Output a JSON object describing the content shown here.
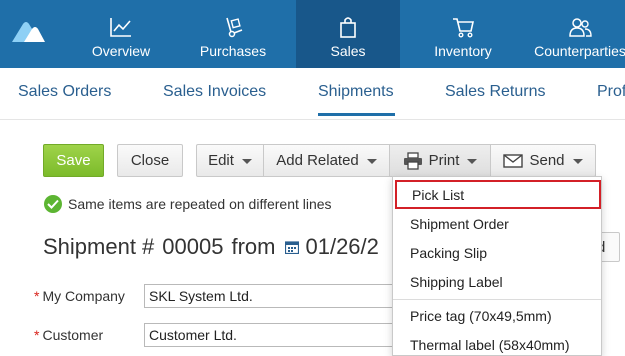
{
  "nav": {
    "items": [
      {
        "label": "Overview",
        "icon": "chart-line-icon"
      },
      {
        "label": "Purchases",
        "icon": "hand-truck-icon"
      },
      {
        "label": "Sales",
        "icon": "shopping-bag-icon",
        "active": true
      },
      {
        "label": "Inventory",
        "icon": "shopping-cart-icon"
      },
      {
        "label": "Counterparties",
        "icon": "people-icon"
      }
    ],
    "colors": {
      "bar": "#1f6fa9",
      "active": "#18578a"
    }
  },
  "subtabs": [
    {
      "label": "Sales Orders"
    },
    {
      "label": "Sales Invoices"
    },
    {
      "label": "Shipments",
      "active": true
    },
    {
      "label": "Sales Returns"
    },
    {
      "label": "Prof"
    }
  ],
  "toolbar": {
    "save": "Save",
    "close": "Close",
    "edit": "Edit",
    "add_related": "Add Related",
    "print": "Print",
    "send": "Send"
  },
  "notice": "Same items are repeated on different lines",
  "document": {
    "prefix": "Shipment #",
    "number": "00005",
    "from": "from",
    "date": "01/26/2",
    "right_button_fragment": "d"
  },
  "form": {
    "my_company_label": "My Company",
    "my_company_value": "SKL System Ltd.",
    "customer_label": "Customer",
    "customer_value": "Customer Ltd."
  },
  "print_menu": {
    "items": [
      "Pick List",
      "Shipment Order",
      "Packing Slip",
      "Shipping Label"
    ],
    "items2": [
      "Price tag (70x49,5mm)",
      "Thermal label (58x40mm)"
    ]
  }
}
